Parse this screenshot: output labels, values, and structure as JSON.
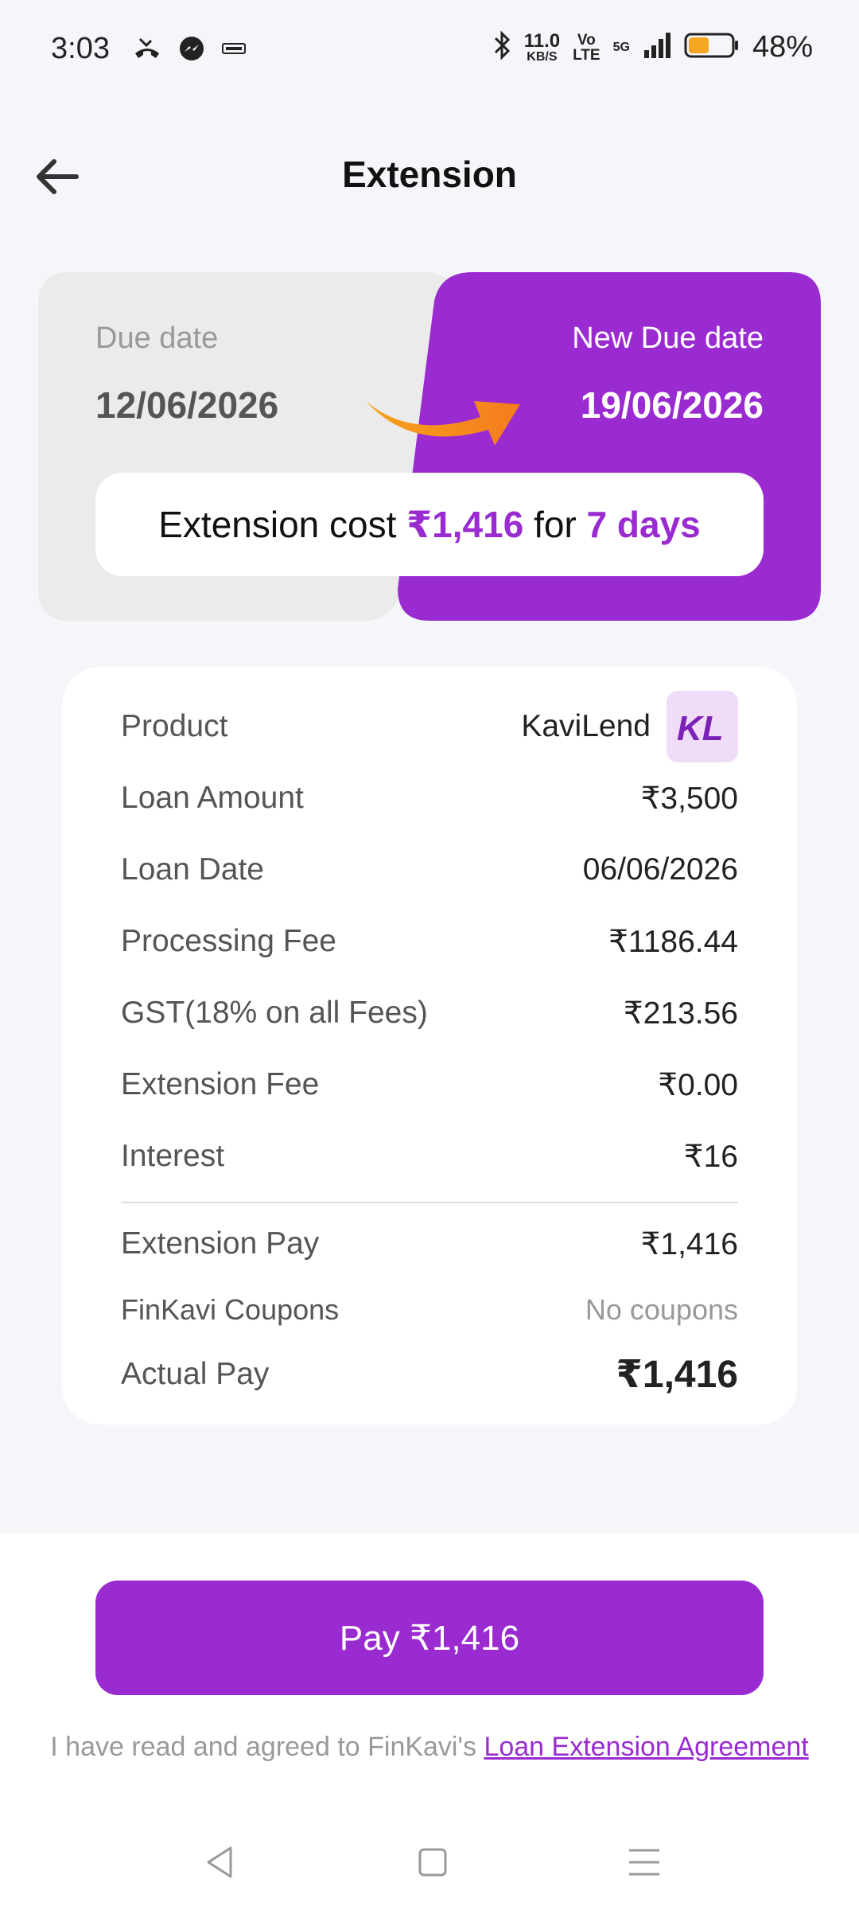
{
  "status_bar": {
    "time": "3:03",
    "speed_value": "11.0",
    "speed_unit": "KB/S",
    "volte_top": "Vo",
    "volte_bottom": "LTE",
    "network": "5G",
    "battery_percent": "48%",
    "battery_level": 0.48,
    "battery_color": "#f5a623"
  },
  "header": {
    "title": "Extension"
  },
  "due": {
    "due_label": "Due date",
    "due_value": "12/06/2026",
    "new_label": "New Due date",
    "new_value": "19/06/2026",
    "cost_prefix": "Extension cost ",
    "cost_amount": "₹1,416",
    "cost_mid": " for ",
    "cost_days": "7 days"
  },
  "details": {
    "product_label": "Product",
    "product_value": "KaviLend",
    "product_logo_text": "KL",
    "rows": [
      {
        "label": "Loan Amount",
        "value": "₹3,500"
      },
      {
        "label": "Loan Date",
        "value": "06/06/2026"
      },
      {
        "label": "Processing Fee",
        "value": "₹1186.44"
      },
      {
        "label": "GST(18% on all Fees)",
        "value": "₹213.56"
      },
      {
        "label": "Extension Fee",
        "value": "₹0.00"
      },
      {
        "label": "Interest",
        "value": "₹16"
      }
    ],
    "extension_pay_label": "Extension Pay",
    "extension_pay_value": "₹1,416",
    "coupons_label": "FinKavi Coupons",
    "coupons_value": "No coupons",
    "actual_pay_label": "Actual Pay",
    "actual_pay_value": "₹1,416"
  },
  "footer": {
    "pay_button": "Pay ₹1,416",
    "agree_text": "I have read and agreed to FinKavi's ",
    "agree_link": "Loan Extension Agreement"
  },
  "colors": {
    "accent": "#9a2bd1",
    "card_grey": "#ebebeb",
    "arrow_start": "#f7a11a",
    "arrow_end": "#f57c1f"
  }
}
